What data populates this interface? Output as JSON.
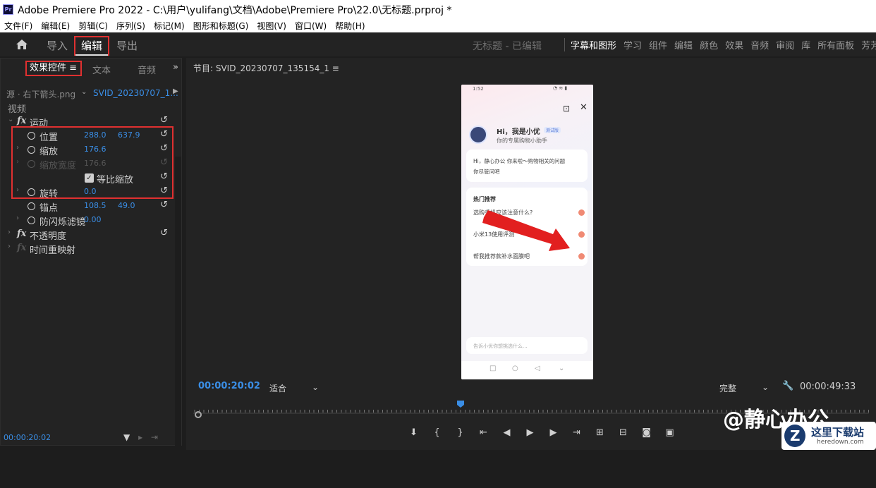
{
  "titlebar": {
    "logo": "Pr",
    "title": "Adobe Premiere Pro 2022 - C:\\用户\\yulifang\\文档\\Adobe\\Premiere Pro\\22.0\\无标题.prproj *"
  },
  "menu": [
    "文件(F)",
    "编辑(E)",
    "剪辑(C)",
    "序列(S)",
    "标记(M)",
    "图形和标题(G)",
    "视图(V)",
    "窗口(W)",
    "帮助(H)"
  ],
  "workspace": {
    "import": "导入",
    "edit": "编辑",
    "export": "导出",
    "status": "无标题 - 已编辑",
    "panels": [
      "字幕和图形",
      "学习",
      "组件",
      "编辑",
      "颜色",
      "效果",
      "音频",
      "审阅",
      "库",
      "所有面板",
      "芳芳的"
    ]
  },
  "effect_panel": {
    "tabs": {
      "effect": "效果控件",
      "text": "文本",
      "audio": "音频",
      "more": "»",
      "menu": "≡"
    },
    "source": "源 · 右下箭头.png",
    "clip": "SVID_20230707_1...",
    "video": "视频",
    "motion": "运动",
    "position": {
      "label": "位置",
      "x": "288.0",
      "y": "637.9"
    },
    "scale": {
      "label": "缩放",
      "value": "176.6"
    },
    "scale_width": {
      "label": "缩放宽度",
      "value": "176.6"
    },
    "uniform": "等比缩放",
    "rotation": {
      "label": "旋转",
      "value": "0.0"
    },
    "anchor": {
      "label": "锚点",
      "x": "108.5",
      "y": "49.0"
    },
    "antiflicker": {
      "label": "防闪烁滤镜",
      "value": "0.00"
    },
    "opacity": "不透明度",
    "timeremap": "时间重映射",
    "timecode": "00:00:20:02"
  },
  "program": {
    "title": "节目: SVID_20230707_135154_1 ≡",
    "timecode": "00:00:20:02",
    "fit": "适合",
    "quality": "完整",
    "duration": "00:00:49:33"
  },
  "phone": {
    "status_time": "1:52",
    "greet": "Hi，我是小优",
    "badge": "测试版",
    "subtitle": "你的专属购物小助手",
    "msg1": "Hi，静心办公 你来啦～购物相关的问题",
    "msg2": "你尽管问吧",
    "hot_title": "热门推荐",
    "hot1": "选购手机应该注意什么?",
    "hot2": "小米13使用评测",
    "hot3": "帮我推荐款补水面膜吧",
    "input": "告诉小优你想挑选什么..."
  },
  "watermark": "@静心办公",
  "download_logo": {
    "main": "这里下载站",
    "sub": "heredown.com"
  }
}
